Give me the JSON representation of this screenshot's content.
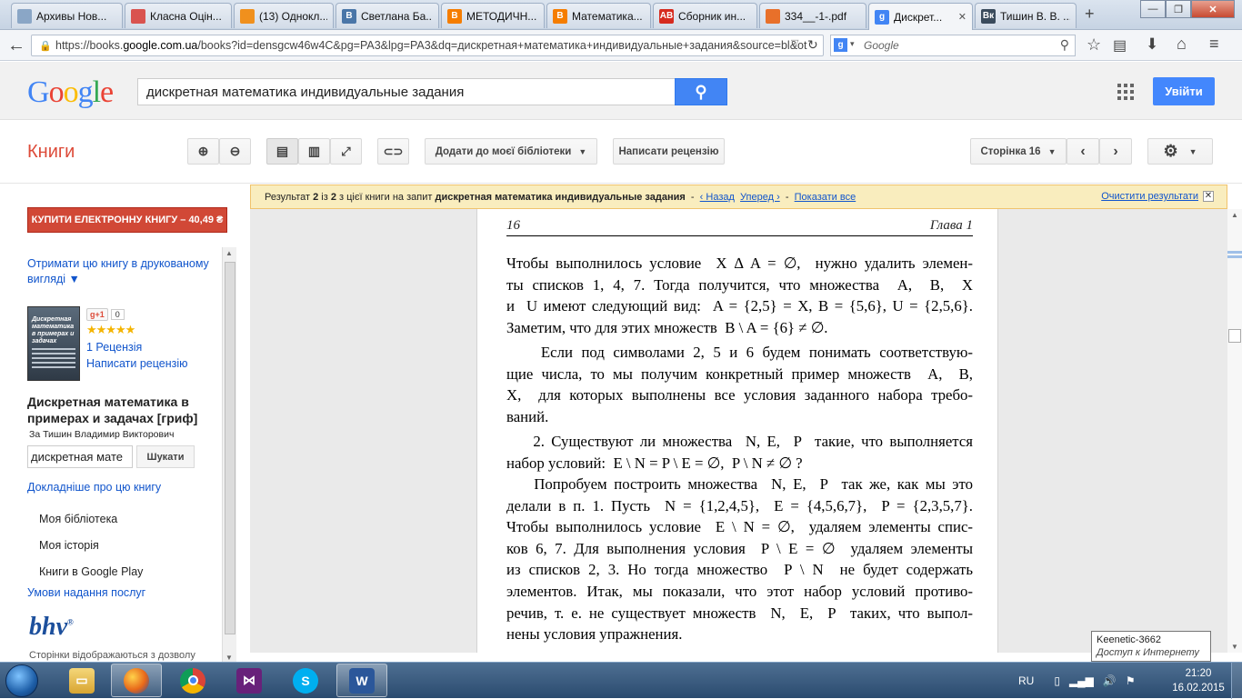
{
  "browser": {
    "tabs": [
      {
        "title": "Архивы Нов...",
        "icon_color": "#8aa6c6"
      },
      {
        "title": "Класна Оцін...",
        "icon_color": "#d9534f"
      },
      {
        "title": "(13) Однокл...",
        "icon_color": "#f0901d"
      },
      {
        "title": "Светлана Ба...",
        "icon_color": "#4a76a8"
      },
      {
        "title": "МЕТОДИЧН...",
        "icon_color": "#f57d00"
      },
      {
        "title": "Математика...",
        "icon_color": "#f57d00"
      },
      {
        "title": "Сборник ин...",
        "icon_color": "#d62b1f"
      },
      {
        "title": "334__-1-.pdf",
        "icon_color": "#e8702a"
      },
      {
        "title": "Дискрет...",
        "icon_color": "#4285f4",
        "active": true
      },
      {
        "title": "Тишин В. В. ...",
        "icon_color": "#3a4b5c"
      }
    ],
    "tab_icon_letters": [
      "",
      "",
      "",
      "В",
      "B",
      "B",
      "AB",
      "",
      "g",
      "Вк"
    ],
    "url_prefix": "https://books.",
    "url_domain": "google.com.ua",
    "url_rest": "/books?id=densgcw46w4C&pg=PA3&lpg=PA3&dq=дискретная+математика+индивидуальные+задания&source=bl&ot",
    "search_engine_placeholder": "Google"
  },
  "google_header": {
    "logo": "Google",
    "query": "дискретная математика индивидуальные задания",
    "signin_label": "Увійти"
  },
  "books_toolbar": {
    "section_title": "Книги",
    "add_library_label": "Додати до моєї бібліотеки",
    "write_review_label": "Написати рецензію",
    "page_label": "Сторінка 16"
  },
  "result_bar": {
    "prefix": "Результат",
    "current": "2",
    "of": "із",
    "total": "2",
    "middle": "з цієї книги на запит",
    "query": "дискретная математика индивидуальные задания",
    "back_label": "‹ Назад",
    "forward_label": "Уперед ›",
    "show_all_label": "Показати все",
    "clear_label": "Очистити результати"
  },
  "sidebar": {
    "buy_label": "КУПИТИ ЕЛЕКТРОННУ КНИГУ – 40,49 ₴",
    "print_link": "Отримати цю книгу в друкованому вигляді ▼",
    "gplus_label": "g+1",
    "gplus_count": "0",
    "rating_stars": "★★★★★",
    "reviews_link": "1 Рецензія",
    "write_review_link": "Написати рецензію",
    "cover_title": "Дискретная математика в примерах и задачах",
    "book_title": "Дискретная математика в примерах и задачах [гриф]",
    "author": "За Тишин Владимир Викторович",
    "search_value": "дискретная мате",
    "search_button": "Шукати",
    "more_link": "Докладніше про цю книгу",
    "menu": [
      "Моя бібліотека",
      "Моя історія",
      "Книги в Google Play"
    ],
    "terms_link": "Умови надання послуг",
    "publisher_logo": "bhv",
    "pages_note": "Сторінки відображаються з дозволу"
  },
  "page": {
    "number": "16",
    "chapter": "Глава 1",
    "paragraphs": [
      [
        "Чтобы выполнилось условие  X ∆ A = ∅,  нужно удалить элемен-",
        "ты списков 1, 4, 7. Тогда получится, что множества  A,  B,  X",
        "и  U имеют следующий вид:  A = {2,5} = X, B = {5,6}, U = {2,5,6}.",
        "Заметим, что для этих множеств  B \\ A = {6} ≠ ∅."
      ],
      [
        "    Если под символами 2, 5 и 6 будем понимать соответствую-",
        "щие числа, то мы получим конкретный пример множеств  A,  B,",
        "X,  для которых выполнены все условия заданного набора требо-",
        "ваний."
      ],
      [
        "    2. Существуют ли множества  N, E,  P  такие, что выполняется",
        "набор условий:  E \\ N = P \\ E = ∅,  P \\ N ≠ ∅ ?"
      ],
      [
        "    Попробуем построить множества  N, E,  P  так же, как мы это",
        "делали в п. 1. Пусть  N = {1,2,4,5},  E = {4,5,6,7},  P = {2,3,5,7}.",
        "Чтобы выполнилось условие  E \\ N = ∅,  удаляем элементы спис-",
        "ков 6, 7. Для выполнения условия  P \\ E = ∅  удаляем элементы",
        "из списков 2, 3. Но тогда множество  P \\ N  не будет содержать",
        "элементов. Итак, мы показали, что этот набор условий противо-",
        "речив, т. е. не существует множеств  N,  E,  P  таких, что выпол-",
        "нены условия упражнения."
      ]
    ]
  },
  "tooltip": {
    "line1": "Keenetic-3662",
    "line2": "Доступ к Интернету"
  },
  "taskbar": {
    "apps": [
      "explorer-icon",
      "firefox-icon",
      "chrome-icon",
      "visual-studio-icon",
      "skype-icon",
      "word-icon"
    ],
    "language": "RU",
    "time": "21:20",
    "date": "16.02.2015"
  }
}
